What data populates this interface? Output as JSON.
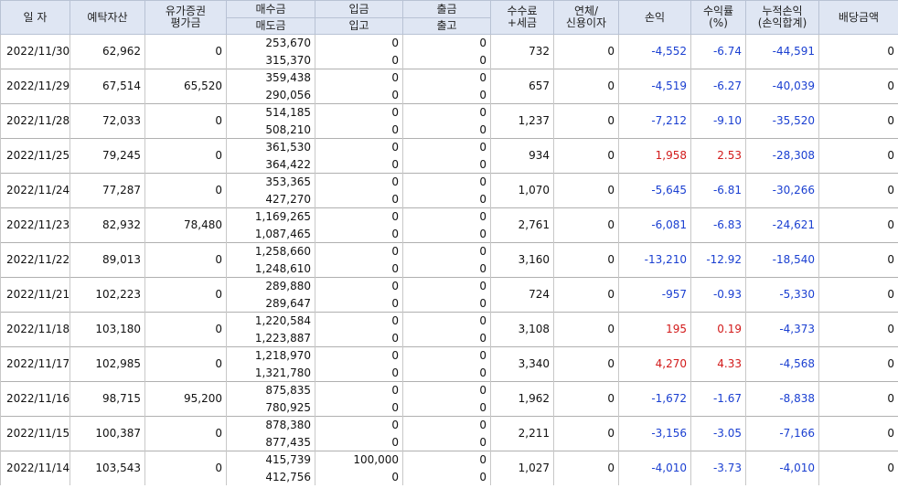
{
  "headers": {
    "date": "일 자",
    "deposit": "예탁자산",
    "securities_1": "유가증권",
    "securities_2": "평가금",
    "buy": "매수금",
    "sell": "매도금",
    "deposit_in": "입금",
    "stock_in": "입고",
    "withdraw": "출금",
    "stock_out": "출고",
    "fee_1": "수수료",
    "fee_2": "+세금",
    "interest_1": "연체/",
    "interest_2": "신용이자",
    "profit": "손익",
    "rate_1": "수익률",
    "rate_2": "(%)",
    "cumulative_1": "누적손익",
    "cumulative_2": "(손익합계)",
    "dividend": "배당금액"
  },
  "rows": [
    {
      "date": "2022/11/30",
      "deposit": "62,962",
      "securities": "0",
      "buy": "253,670",
      "sell": "315,370",
      "deposit_in": "0",
      "stock_in": "0",
      "withdraw": "0",
      "stock_out": "0",
      "fee": "732",
      "interest": "0",
      "profit": "-4,552",
      "rate": "-6.74",
      "cumulative": "-44,591",
      "dividend": "0",
      "sign": "neg"
    },
    {
      "date": "2022/11/29",
      "deposit": "67,514",
      "securities": "65,520",
      "buy": "359,438",
      "sell": "290,056",
      "deposit_in": "0",
      "stock_in": "0",
      "withdraw": "0",
      "stock_out": "0",
      "fee": "657",
      "interest": "0",
      "profit": "-4,519",
      "rate": "-6.27",
      "cumulative": "-40,039",
      "dividend": "0",
      "sign": "neg"
    },
    {
      "date": "2022/11/28",
      "deposit": "72,033",
      "securities": "0",
      "buy": "514,185",
      "sell": "508,210",
      "deposit_in": "0",
      "stock_in": "0",
      "withdraw": "0",
      "stock_out": "0",
      "fee": "1,237",
      "interest": "0",
      "profit": "-7,212",
      "rate": "-9.10",
      "cumulative": "-35,520",
      "dividend": "0",
      "sign": "neg"
    },
    {
      "date": "2022/11/25",
      "deposit": "79,245",
      "securities": "0",
      "buy": "361,530",
      "sell": "364,422",
      "deposit_in": "0",
      "stock_in": "0",
      "withdraw": "0",
      "stock_out": "0",
      "fee": "934",
      "interest": "0",
      "profit": "1,958",
      "rate": "2.53",
      "cumulative": "-28,308",
      "dividend": "0",
      "sign": "pos"
    },
    {
      "date": "2022/11/24",
      "deposit": "77,287",
      "securities": "0",
      "buy": "353,365",
      "sell": "427,270",
      "deposit_in": "0",
      "stock_in": "0",
      "withdraw": "0",
      "stock_out": "0",
      "fee": "1,070",
      "interest": "0",
      "profit": "-5,645",
      "rate": "-6.81",
      "cumulative": "-30,266",
      "dividend": "0",
      "sign": "neg"
    },
    {
      "date": "2022/11/23",
      "deposit": "82,932",
      "securities": "78,480",
      "buy": "1,169,265",
      "sell": "1,087,465",
      "deposit_in": "0",
      "stock_in": "0",
      "withdraw": "0",
      "stock_out": "0",
      "fee": "2,761",
      "interest": "0",
      "profit": "-6,081",
      "rate": "-6.83",
      "cumulative": "-24,621",
      "dividend": "0",
      "sign": "neg"
    },
    {
      "date": "2022/11/22",
      "deposit": "89,013",
      "securities": "0",
      "buy": "1,258,660",
      "sell": "1,248,610",
      "deposit_in": "0",
      "stock_in": "0",
      "withdraw": "0",
      "stock_out": "0",
      "fee": "3,160",
      "interest": "0",
      "profit": "-13,210",
      "rate": "-12.92",
      "cumulative": "-18,540",
      "dividend": "0",
      "sign": "neg"
    },
    {
      "date": "2022/11/21",
      "deposit": "102,223",
      "securities": "0",
      "buy": "289,880",
      "sell": "289,647",
      "deposit_in": "0",
      "stock_in": "0",
      "withdraw": "0",
      "stock_out": "0",
      "fee": "724",
      "interest": "0",
      "profit": "-957",
      "rate": "-0.93",
      "cumulative": "-5,330",
      "dividend": "0",
      "sign": "neg"
    },
    {
      "date": "2022/11/18",
      "deposit": "103,180",
      "securities": "0",
      "buy": "1,220,584",
      "sell": "1,223,887",
      "deposit_in": "0",
      "stock_in": "0",
      "withdraw": "0",
      "stock_out": "0",
      "fee": "3,108",
      "interest": "0",
      "profit": "195",
      "rate": "0.19",
      "cumulative": "-4,373",
      "dividend": "0",
      "sign": "pos"
    },
    {
      "date": "2022/11/17",
      "deposit": "102,985",
      "securities": "0",
      "buy": "1,218,970",
      "sell": "1,321,780",
      "deposit_in": "0",
      "stock_in": "0",
      "withdraw": "0",
      "stock_out": "0",
      "fee": "3,340",
      "interest": "0",
      "profit": "4,270",
      "rate": "4.33",
      "cumulative": "-4,568",
      "dividend": "0",
      "sign": "pos"
    },
    {
      "date": "2022/11/16",
      "deposit": "98,715",
      "securities": "95,200",
      "buy": "875,835",
      "sell": "780,925",
      "deposit_in": "0",
      "stock_in": "0",
      "withdraw": "0",
      "stock_out": "0",
      "fee": "1,962",
      "interest": "0",
      "profit": "-1,672",
      "rate": "-1.67",
      "cumulative": "-8,838",
      "dividend": "0",
      "sign": "neg"
    },
    {
      "date": "2022/11/15",
      "deposit": "100,387",
      "securities": "0",
      "buy": "878,380",
      "sell": "877,435",
      "deposit_in": "0",
      "stock_in": "0",
      "withdraw": "0",
      "stock_out": "0",
      "fee": "2,211",
      "interest": "0",
      "profit": "-3,156",
      "rate": "-3.05",
      "cumulative": "-7,166",
      "dividend": "0",
      "sign": "neg"
    },
    {
      "date": "2022/11/14",
      "deposit": "103,543",
      "securities": "0",
      "buy": "415,739",
      "sell": "412,756",
      "deposit_in": "100,000",
      "stock_in": "0",
      "withdraw": "0",
      "stock_out": "0",
      "fee": "1,027",
      "interest": "0",
      "profit": "-4,010",
      "rate": "-3.73",
      "cumulative": "-4,010",
      "dividend": "0",
      "sign": "neg"
    }
  ]
}
